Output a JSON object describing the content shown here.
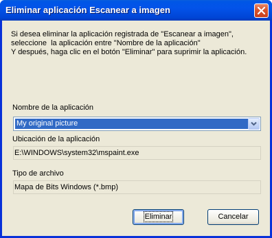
{
  "window": {
    "title": "Eliminar aplicación Escanear a imagen",
    "close_icon": "close-icon"
  },
  "info": {
    "line1": "Si desea eliminar la aplicación registrada de \"Escanear a imagen\",",
    "line2": "seleccione  la aplicación entre \"Nombre de la aplicación\"",
    "line3": "Y después, haga clic en el botón \"Eliminar\" para suprimir la aplicación."
  },
  "app_name": {
    "label": "Nombre de la aplicación",
    "selected": "My original picture"
  },
  "app_location": {
    "label": "Ubicación de la aplicación",
    "value": "E:\\WINDOWS\\system32\\mspaint.exe"
  },
  "file_type": {
    "label": "Tipo de archivo",
    "value": "Mapa de Bits Windows (*.bmp)"
  },
  "buttons": {
    "delete": "Eliminar",
    "cancel": "Cancelar"
  },
  "colors": {
    "titlebar": "#0353e9",
    "selection": "#316ac5",
    "client_bg": "#ece9d8"
  }
}
